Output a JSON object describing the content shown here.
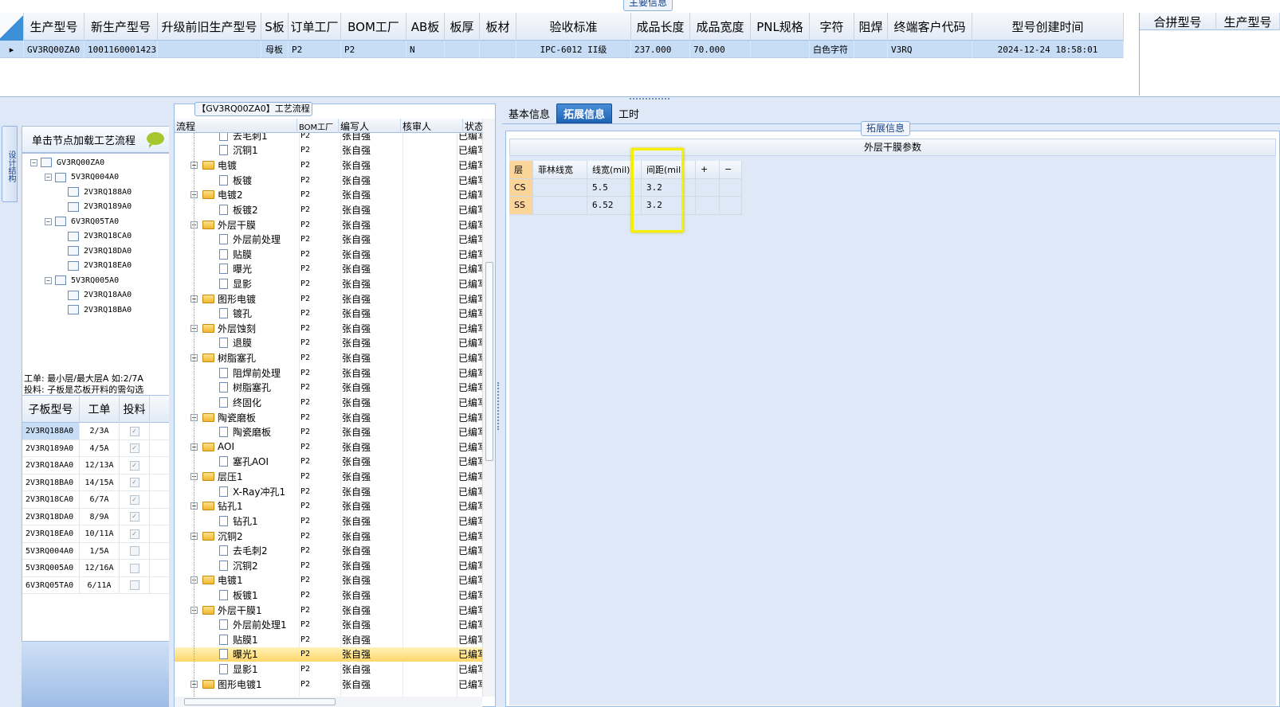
{
  "top": {
    "main_info_tab": "主要信息",
    "columns": [
      "",
      "生产型号",
      "新生产型号",
      "升级前旧生产型号",
      "S板",
      "订单工厂",
      "BOM工厂",
      "AB板",
      "板厚",
      "板材",
      "验收标准",
      "成品长度",
      "成品宽度",
      "PNL规格",
      "字符",
      "阻焊",
      "终端客户代码",
      "型号创建时间"
    ],
    "row": [
      "▸",
      "GV3RQ00ZA0",
      "10011600014231",
      "",
      "母板",
      "P2",
      "P2",
      "N",
      "",
      "",
      "IPC-6012 II级",
      "237.000",
      "70.000",
      "",
      "白色字符",
      "",
      "V3RQ",
      "2024-12-24 18:58:01"
    ],
    "right_columns": [
      "合拼型号",
      "生产型号"
    ],
    "scroll_left": "◂",
    "scroll_right": "▸"
  },
  "left": {
    "vtab": "设计结构",
    "load_hint": "单击节点加载工艺流程",
    "tree": [
      {
        "label": "GV3RQ00ZA0",
        "level": 0,
        "exp": "−"
      },
      {
        "label": "5V3RQ004A0",
        "level": 1,
        "exp": "−"
      },
      {
        "label": "2V3RQ188A0",
        "level": 2,
        "exp": ""
      },
      {
        "label": "2V3RQ189A0",
        "level": 2,
        "exp": ""
      },
      {
        "label": "6V3RQ05TA0",
        "level": 1,
        "exp": "−"
      },
      {
        "label": "2V3RQ18CA0",
        "level": 2,
        "exp": ""
      },
      {
        "label": "2V3RQ18DA0",
        "level": 2,
        "exp": ""
      },
      {
        "label": "2V3RQ18EA0",
        "level": 2,
        "exp": ""
      },
      {
        "label": "5V3RQ005A0",
        "level": 1,
        "exp": "−"
      },
      {
        "label": "2V3RQ18AA0",
        "level": 2,
        "exp": ""
      },
      {
        "label": "2V3RQ18BA0",
        "level": 2,
        "exp": ""
      }
    ],
    "note1": "工单: 最小层/最大层A 如:2/7A",
    "note2": "投料: 子板是芯板开料的需勾选",
    "sub_columns": [
      "子板型号",
      "工单",
      "投料"
    ],
    "sub_rows": [
      {
        "model": "2V3RQ188A0",
        "order": "2/3A",
        "feed": true
      },
      {
        "model": "2V3RQ189A0",
        "order": "4/5A",
        "feed": true
      },
      {
        "model": "2V3RQ18AA0",
        "order": "12/13A",
        "feed": true
      },
      {
        "model": "2V3RQ18BA0",
        "order": "14/15A",
        "feed": true
      },
      {
        "model": "2V3RQ18CA0",
        "order": "6/7A",
        "feed": true
      },
      {
        "model": "2V3RQ18DA0",
        "order": "8/9A",
        "feed": true
      },
      {
        "model": "2V3RQ18EA0",
        "order": "10/11A",
        "feed": true
      },
      {
        "model": "5V3RQ004A0",
        "order": "1/5A",
        "feed": false
      },
      {
        "model": "5V3RQ005A0",
        "order": "12/16A",
        "feed": false
      },
      {
        "model": "6V3RQ05TA0",
        "order": "6/11A",
        "feed": false
      }
    ]
  },
  "mid": {
    "title": "【GV3RQ00ZA0】工艺流程",
    "columns": [
      "流程",
      "BOM工厂",
      "编写人",
      "核审人",
      "状态"
    ],
    "rows": [
      {
        "name": "去毛刺1",
        "kind": "file",
        "bom": "P2",
        "author": "张自强",
        "status": "已编写"
      },
      {
        "name": "沉铜1",
        "kind": "file",
        "bom": "P2",
        "author": "张自强",
        "status": "已编写"
      },
      {
        "name": "电镀",
        "kind": "folder",
        "bom": "P2",
        "author": "张自强",
        "status": "已编写"
      },
      {
        "name": "板镀",
        "kind": "file",
        "bom": "P2",
        "author": "张自强",
        "status": "已编写"
      },
      {
        "name": "电镀2",
        "kind": "folder",
        "bom": "P2",
        "author": "张自强",
        "status": "已编写"
      },
      {
        "name": "板镀2",
        "kind": "file",
        "bom": "P2",
        "author": "张自强",
        "status": "已编写"
      },
      {
        "name": "外层干膜",
        "kind": "folder",
        "bom": "P2",
        "author": "张自强",
        "status": "已编写"
      },
      {
        "name": "外层前处理",
        "kind": "file",
        "bom": "P2",
        "author": "张自强",
        "status": "已编写"
      },
      {
        "name": "贴膜",
        "kind": "file",
        "bom": "P2",
        "author": "张自强",
        "status": "已编写"
      },
      {
        "name": "曝光",
        "kind": "file",
        "bom": "P2",
        "author": "张自强",
        "status": "已编写"
      },
      {
        "name": "显影",
        "kind": "file",
        "bom": "P2",
        "author": "张自强",
        "status": "已编写"
      },
      {
        "name": "图形电镀",
        "kind": "folder",
        "bom": "P2",
        "author": "张自强",
        "status": "已编写"
      },
      {
        "name": "镀孔",
        "kind": "file",
        "bom": "P2",
        "author": "张自强",
        "status": "已编写"
      },
      {
        "name": "外层蚀刻",
        "kind": "folder",
        "bom": "P2",
        "author": "张自强",
        "status": "已编写"
      },
      {
        "name": "退膜",
        "kind": "file",
        "bom": "P2",
        "author": "张自强",
        "status": "已编写"
      },
      {
        "name": "树脂塞孔",
        "kind": "folder",
        "bom": "P2",
        "author": "张自强",
        "status": "已编写"
      },
      {
        "name": "阻焊前处理",
        "kind": "file",
        "bom": "P2",
        "author": "张自强",
        "status": "已编写"
      },
      {
        "name": "树脂塞孔",
        "kind": "file",
        "bom": "P2",
        "author": "张自强",
        "status": "已编写"
      },
      {
        "name": "终固化",
        "kind": "file",
        "bom": "P2",
        "author": "张自强",
        "status": "已编写"
      },
      {
        "name": "陶瓷磨板",
        "kind": "folder",
        "bom": "P2",
        "author": "张自强",
        "status": "已编写"
      },
      {
        "name": "陶瓷磨板",
        "kind": "file",
        "bom": "P2",
        "author": "张自强",
        "status": "已编写"
      },
      {
        "name": "AOI",
        "kind": "folder",
        "bom": "P2",
        "author": "张自强",
        "status": "已编写"
      },
      {
        "name": "塞孔AOI",
        "kind": "file",
        "bom": "P2",
        "author": "张自强",
        "status": "已编写"
      },
      {
        "name": "层压1",
        "kind": "folder",
        "bom": "P2",
        "author": "张自强",
        "status": "已编写"
      },
      {
        "name": "X-Ray冲孔1",
        "kind": "file",
        "bom": "P2",
        "author": "张自强",
        "status": "已编写"
      },
      {
        "name": "钻孔1",
        "kind": "folder",
        "bom": "P2",
        "author": "张自强",
        "status": "已编写"
      },
      {
        "name": "钻孔1",
        "kind": "file",
        "bom": "P2",
        "author": "张自强",
        "status": "已编写"
      },
      {
        "name": "沉铜2",
        "kind": "folder",
        "bom": "P2",
        "author": "张自强",
        "status": "已编写"
      },
      {
        "name": "去毛刺2",
        "kind": "file",
        "bom": "P2",
        "author": "张自强",
        "status": "已编写"
      },
      {
        "name": "沉铜2",
        "kind": "file",
        "bom": "P2",
        "author": "张自强",
        "status": "已编写"
      },
      {
        "name": "电镀1",
        "kind": "folder",
        "bom": "P2",
        "author": "张自强",
        "status": "已编写"
      },
      {
        "name": "板镀1",
        "kind": "file",
        "bom": "P2",
        "author": "张自强",
        "status": "已编写"
      },
      {
        "name": "外层干膜1",
        "kind": "folder",
        "bom": "P2",
        "author": "张自强",
        "status": "已编写"
      },
      {
        "name": "外层前处理1",
        "kind": "file",
        "bom": "P2",
        "author": "张自强",
        "status": "已编写"
      },
      {
        "name": "贴膜1",
        "kind": "file",
        "bom": "P2",
        "author": "张自强",
        "status": "已编写"
      },
      {
        "name": "曝光1",
        "kind": "file",
        "bom": "P2",
        "author": "张自强",
        "status": "已编写",
        "selected": true
      },
      {
        "name": "显影1",
        "kind": "file",
        "bom": "P2",
        "author": "张自强",
        "status": "已编写"
      },
      {
        "name": "图形电镀1",
        "kind": "folder",
        "bom": "P2",
        "author": "张自强",
        "status": "已编写"
      }
    ]
  },
  "right": {
    "tabs": [
      "基本信息",
      "拓展信息",
      "工时"
    ],
    "active_tab": 1,
    "group_title": "拓展信息",
    "film_title": "外层干膜参数",
    "film_columns": [
      "层",
      "菲林线宽",
      "线宽(mil)",
      "间距(mil)",
      "+",
      "−"
    ],
    "film_rows": [
      [
        "CS",
        "",
        "5.5",
        "3.2",
        "",
        ""
      ],
      [
        "SS",
        "",
        "6.52",
        "3.2",
        "",
        ""
      ]
    ]
  },
  "colors": {
    "accent": "#1f63b5",
    "selection": "#c7dcf5",
    "highlight_box": "#f5f000",
    "row_selected": "#ffd66a"
  }
}
